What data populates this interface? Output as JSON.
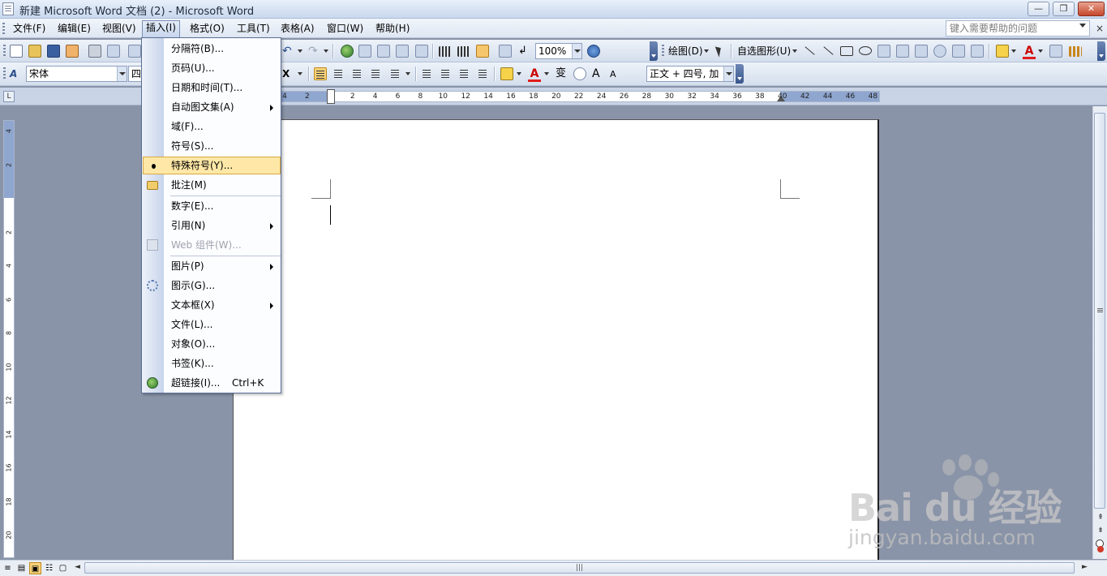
{
  "window": {
    "title": "新建 Microsoft Word 文档 (2) - Microsoft Word",
    "buttons": {
      "minimize": "—",
      "maximize": "❐",
      "close": "✕"
    }
  },
  "menubar": {
    "items": [
      {
        "label": "文件(F)"
      },
      {
        "label": "编辑(E)"
      },
      {
        "label": "视图(V)"
      },
      {
        "label": "插入(I)",
        "active": true
      },
      {
        "label": "格式(O)"
      },
      {
        "label": "工具(T)"
      },
      {
        "label": "表格(A)"
      },
      {
        "label": "窗口(W)"
      },
      {
        "label": "帮助(H)"
      }
    ],
    "help_placeholder": "键入需要帮助的问题",
    "doc_close": "×"
  },
  "toolbar_standard": {
    "zoom": "100%"
  },
  "toolbar_drawing": {
    "draw_label": "绘图(D)",
    "autoshapes_label": "自选图形(U)"
  },
  "toolbar_formatting": {
    "font_name": "宋体",
    "font_size": "四",
    "style": "正文 + 四号, 加"
  },
  "ruler": {
    "ticks": [
      "4",
      "2",
      "",
      "2",
      "4",
      "6",
      "8",
      "10",
      "12",
      "14",
      "16",
      "18",
      "20",
      "22",
      "24",
      "26",
      "28",
      "30",
      "32",
      "34",
      "36",
      "38",
      "40",
      "42",
      "44",
      "46",
      "48"
    ],
    "vertical_ticks": [
      "4",
      "2",
      "",
      "2",
      "4",
      "6",
      "8",
      "10",
      "12",
      "14",
      "16",
      "18",
      "20"
    ],
    "corner": "L"
  },
  "insert_menu": {
    "items": [
      {
        "label": "分隔符(B)...",
        "submenu": false
      },
      {
        "label": "页码(U)...",
        "submenu": false
      },
      {
        "label": "日期和时间(T)...",
        "submenu": false
      },
      {
        "label": "自动图文集(A)",
        "submenu": true
      },
      {
        "label": "域(F)...",
        "submenu": false
      },
      {
        "label": "符号(S)...",
        "submenu": false
      },
      {
        "label": "特殊符号(Y)...",
        "submenu": false,
        "hover": true,
        "icon": "bullet-icon"
      },
      {
        "label": "批注(M)",
        "submenu": false,
        "icon": "comment-folder-icon"
      },
      {
        "label": "数字(E)...",
        "submenu": false
      },
      {
        "label": "引用(N)",
        "submenu": true
      },
      {
        "label": "Web 组件(W)...",
        "submenu": false,
        "disabled": true,
        "icon": "web-component-icon"
      },
      {
        "label": "图片(P)",
        "submenu": true
      },
      {
        "label": "图示(G)...",
        "submenu": false,
        "icon": "diagram-icon"
      },
      {
        "label": "文本框(X)",
        "submenu": true
      },
      {
        "label": "文件(L)...",
        "submenu": false
      },
      {
        "label": "对象(O)...",
        "submenu": false
      },
      {
        "label": "书签(K)...",
        "submenu": false
      },
      {
        "label": "超链接(I)...",
        "submenu": false,
        "icon": "hyperlink-globe-icon",
        "shortcut": "Ctrl+K"
      }
    ]
  },
  "watermark": {
    "brand": "Bai du 经验",
    "url": "jingyan.baidu.com"
  },
  "scrollbar": {
    "grip": "|||",
    "up": "▲",
    "down": "▼",
    "prev_page": "⇞",
    "next_page": "⇟",
    "left": "◄",
    "right": "►"
  },
  "view_buttons": [
    "≡",
    "▤",
    "▣",
    "☷",
    "▢"
  ]
}
